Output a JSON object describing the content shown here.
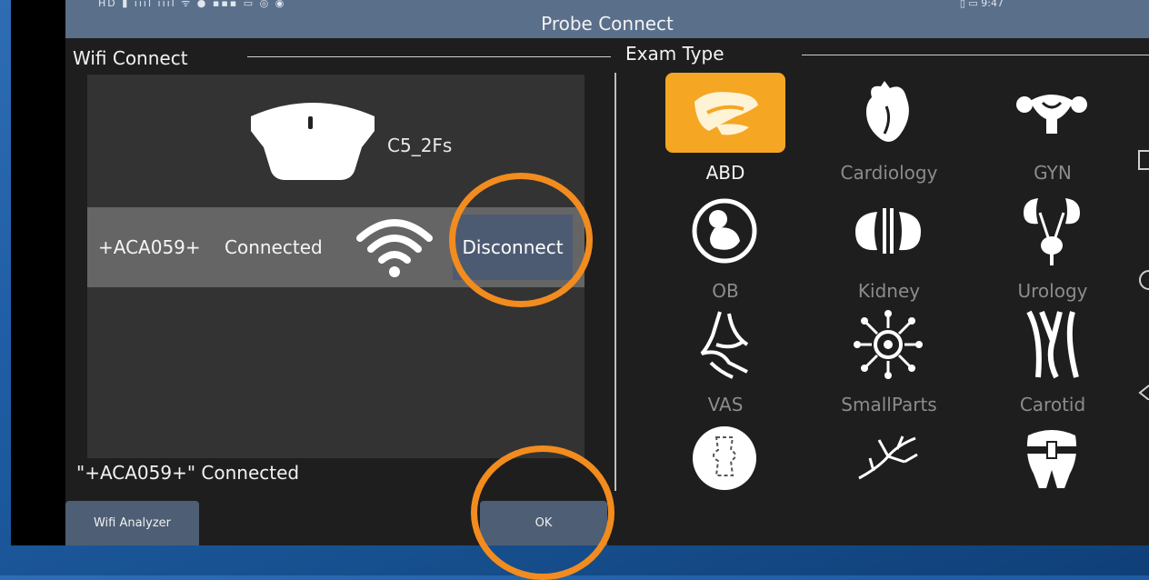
{
  "app": {
    "title": "Probe Connect"
  },
  "statusbar": {
    "left": "HD ▮ ıııl ıııl ᯤ ● ▪▪▪ ▭ ◎ ◉",
    "right": "▯ ▭ 9:47"
  },
  "wifi": {
    "section_label": "Wifi Connect",
    "probe_name": "C5_2Fs",
    "ssid": "+ACA059+",
    "state": "Connected",
    "disconnect_label": "Disconnect",
    "status_message": "\"+ACA059+\" Connected"
  },
  "exam": {
    "section_label": "Exam Type",
    "selected": "ABD",
    "types": [
      {
        "label": "ABD",
        "icon": "liver-icon"
      },
      {
        "label": "Cardiology",
        "icon": "heart-icon"
      },
      {
        "label": "GYN",
        "icon": "uterus-icon"
      },
      {
        "label": "OB",
        "icon": "fetus-icon"
      },
      {
        "label": "Kidney",
        "icon": "kidney-icon"
      },
      {
        "label": "Urology",
        "icon": "bladder-icon"
      },
      {
        "label": "VAS",
        "icon": "vessels-icon"
      },
      {
        "label": "SmallParts",
        "icon": "smallparts-icon"
      },
      {
        "label": "Carotid",
        "icon": "carotid-icon"
      },
      {
        "label": "",
        "icon": "joint-icon"
      },
      {
        "label": "",
        "icon": "nerve-icon"
      },
      {
        "label": "",
        "icon": "tooth-icon"
      }
    ]
  },
  "footer": {
    "wifi_analyzer_label": "Wifi Analyzer",
    "ok_label": "OK"
  },
  "colors": {
    "accent": "#f5a623",
    "button": "#4e5e74",
    "highlight_ring": "#f28c1e"
  }
}
